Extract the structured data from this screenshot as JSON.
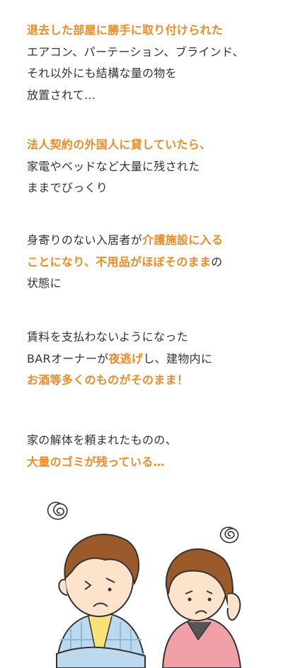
{
  "colors": {
    "accent": "#f08a24",
    "text": "#333333"
  },
  "blocks": [
    {
      "lines": [
        [
          {
            "t": "退去した部屋に勝手に取り付けられた",
            "hl": true
          }
        ],
        [
          {
            "t": "エアコン、パーテーション、ブラインド、",
            "hl": false
          }
        ],
        [
          {
            "t": "それ以外にも結構な量の物を",
            "hl": false
          }
        ],
        [
          {
            "t": "放置されて…",
            "hl": false
          }
        ]
      ]
    },
    {
      "lines": [
        [
          {
            "t": "法人契約の外国人に貸していたら、",
            "hl": true
          }
        ],
        [
          {
            "t": "家電やベッドなど大量に残された",
            "hl": false
          }
        ],
        [
          {
            "t": "ままでびっくり",
            "hl": false
          }
        ]
      ]
    },
    {
      "lines": [
        [
          {
            "t": "身寄りのない入居者が",
            "hl": false
          },
          {
            "t": "介護施設に入る",
            "hl": true
          }
        ],
        [
          {
            "t": "ことになり、不用品がほぼそのまま",
            "hl": true
          },
          {
            "t": "の",
            "hl": false
          }
        ],
        [
          {
            "t": "状態に",
            "hl": false
          }
        ]
      ]
    },
    {
      "lines": [
        [
          {
            "t": "賃料を支払わないようになった",
            "hl": false
          }
        ],
        [
          {
            "t": "BARオーナーが",
            "hl": false
          },
          {
            "t": "夜逃げ",
            "hl": true
          },
          {
            "t": "し、建物内に",
            "hl": false
          }
        ],
        [
          {
            "t": "お酒等多くのものがそのまま！",
            "hl": true
          }
        ]
      ]
    },
    {
      "lines": [
        [
          {
            "t": "家の解体を頼まれたものの、",
            "hl": false
          }
        ],
        [
          {
            "t": "大量のゴミが残っている…",
            "hl": true
          }
        ]
      ]
    }
  ]
}
